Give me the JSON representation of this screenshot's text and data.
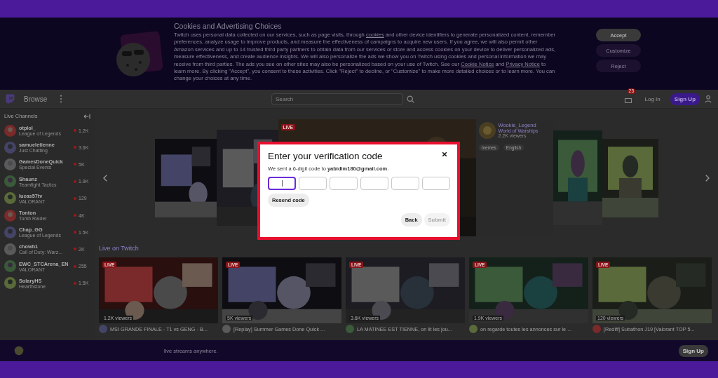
{
  "cookie_banner": {
    "title": "Cookies and Advertising Choices",
    "text": [
      {
        "text": "Twitch uses personal data collected on our services, such as page visits, through ",
        "link": false
      },
      {
        "text": "cookies",
        "link": true
      },
      {
        "text": " and other device identifiers to generate personalized content, remember preferences, analyze usage to improve products, and measure the effectiveness of campaigns to acquire new users. If you agree, we will also permit other Amazon services and up to 14 trusted third party partners to obtain data from our services or store and access cookies on your device to deliver personalized ads, measure effectiveness, and create audience insights. We will also personalize the ads we show you on Twitch using cookies and personal information we may receive from third parties. The ads you see on other sites may also be personalized based on your use of Twitch. See our ",
        "link": false
      },
      {
        "text": "Cookie Notice",
        "link": true
      },
      {
        "text": " and ",
        "link": false
      },
      {
        "text": "Privacy Notice",
        "link": true
      },
      {
        "text": " to learn more. By clicking \"Accept\", you consent to these activities. Click \"Reject\" to decline, or \"Customize\" to make more detailed choices or to learn more. You can change your choices at any time.",
        "link": false
      }
    ],
    "buttons": [
      "Accept",
      "Customize",
      "Reject"
    ]
  },
  "top_nav": {
    "browse": "Browse",
    "search": {
      "placeholder": "Search"
    },
    "notification_count": "25",
    "log_in": "Log In",
    "sign_up": "Sign Up"
  },
  "sidebar": {
    "title": "Live Channels",
    "channels": [
      {
        "name": "otplol_",
        "game": "League of Legends",
        "viewers": "1.2K"
      },
      {
        "name": "samueletienne",
        "game": "Just Chatting",
        "viewers": "3.6K"
      },
      {
        "name": "GamesDoneQuick",
        "game": "Special Events",
        "viewers": "5K"
      },
      {
        "name": "Shaunz",
        "game": "Teamfight Tactics",
        "viewers": "1.9K"
      },
      {
        "name": "lucas57tv",
        "game": "VALORANT",
        "viewers": "129"
      },
      {
        "name": "Tonton",
        "game": "Tomb Raider",
        "viewers": "4K"
      },
      {
        "name": "Chap_GG",
        "game": "League of Legends",
        "viewers": "1.5K"
      },
      {
        "name": "chowh1",
        "game": "Call of Duty: Warz...",
        "viewers": "2K"
      },
      {
        "name": "EWC_STCArena_EN",
        "game": "VALORANT",
        "viewers": "255"
      },
      {
        "name": "SolaryHS",
        "game": "Hearthstone",
        "viewers": "1.5K"
      }
    ]
  },
  "carousel": {
    "live_badge": "LIVE",
    "channel": "Wookie_Legend",
    "game": "World of Warships",
    "viewers": "2.2K viewers",
    "tags": [
      "memes",
      "English"
    ]
  },
  "modal": {
    "title": "Enter your verification code",
    "message": "We sent a 6-digit code to **yabidim180@gmail.com**.",
    "code_boxes": [
      {
        "focused": true
      },
      {
        "focused": false
      },
      {
        "focused": false
      },
      {
        "focused": false
      },
      {
        "focused": false
      },
      {
        "focused": false
      }
    ],
    "resend": "Resend code",
    "back": "Back",
    "submit": {
      "label": "Submit",
      "disabled": true
    }
  },
  "live_section": {
    "title": "Live on Twitch",
    "streams": [
      {
        "badge": "LIVE",
        "viewers": "1.2K viewers",
        "title": "MSI GRANDE FINALE - T1 vs GENG - B..."
      },
      {
        "badge": "LIVE",
        "viewers": "5K viewers",
        "title": "[Replay] Summer Games Done Quick ..."
      },
      {
        "badge": "LIVE",
        "viewers": "3.6K viewers",
        "title": "LA MATINEE EST TIENNE, on lit les jou..."
      },
      {
        "badge": "LIVE",
        "viewers": "1.9K viewers",
        "title": "on regarde toutes les annonces sur le ..."
      },
      {
        "badge": "LIVE",
        "viewers": "120 viewers",
        "title": "[Rediff] Subathon J19 [Valorant TOP 5..."
      }
    ]
  },
  "bottom_bar": {
    "text": "live streams anywhere.",
    "sign_up": "Sign Up"
  }
}
